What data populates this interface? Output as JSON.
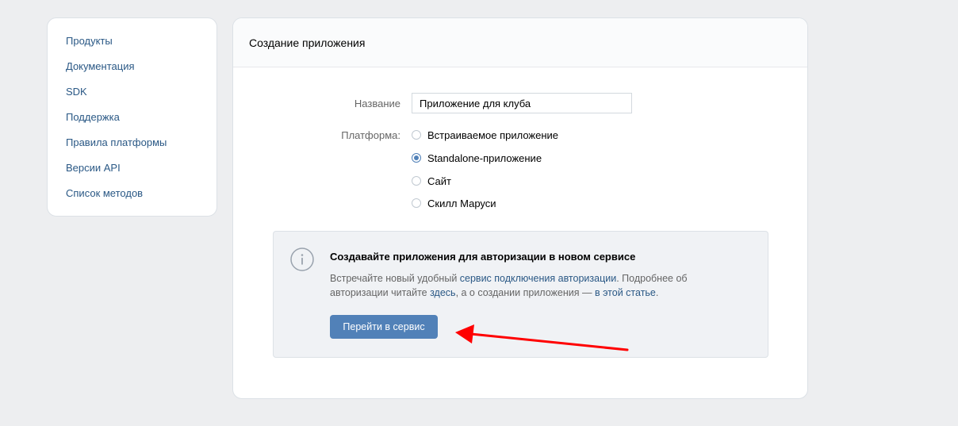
{
  "sidebar": {
    "items": [
      {
        "label": "Продукты"
      },
      {
        "label": "Документация"
      },
      {
        "label": "SDK"
      },
      {
        "label": "Поддержка"
      },
      {
        "label": "Правила платформы"
      },
      {
        "label": "Версии API"
      },
      {
        "label": "Список методов"
      }
    ]
  },
  "main": {
    "title": "Создание приложения",
    "form": {
      "name_label": "Название",
      "name_value": "Приложение для клуба",
      "platform_label": "Платформа:",
      "platforms": [
        {
          "label": "Встраиваемое приложение",
          "checked": false
        },
        {
          "label": "Standalone-приложение",
          "checked": true
        },
        {
          "label": "Сайт",
          "checked": false
        },
        {
          "label": "Скилл Маруси",
          "checked": false
        }
      ]
    },
    "info": {
      "icon": "info-icon",
      "title": "Создавайте приложения для авторизации в новом сервисе",
      "text_1": "Встречайте новый удобный ",
      "link_1": "сервис подключения авторизации",
      "text_2": ". Подробнее об авторизации читайте ",
      "link_2": "здесь",
      "text_3": ", а о создании приложения — ",
      "link_3": "в этой статье",
      "text_4": ".",
      "button_label": "Перейти в сервис"
    }
  },
  "colors": {
    "background": "#edeef0",
    "link": "#2a5885",
    "accent": "#5181b8",
    "annotation_arrow": "#ff0000"
  }
}
